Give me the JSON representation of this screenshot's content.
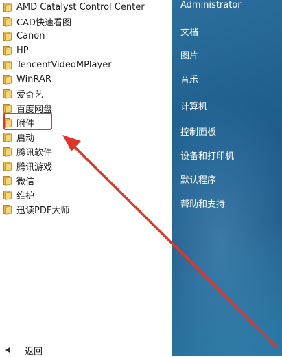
{
  "programs": [
    {
      "label": "AMD Catalyst Control Center",
      "icon": "folder-icon"
    },
    {
      "label": "CAD快速看图",
      "icon": "folder-icon"
    },
    {
      "label": "Canon",
      "icon": "folder-icon"
    },
    {
      "label": "HP",
      "icon": "folder-icon"
    },
    {
      "label": "TencentVideoMPlayer",
      "icon": "folder-icon"
    },
    {
      "label": "WinRAR",
      "icon": "folder-icon"
    },
    {
      "label": "爱奇艺",
      "icon": "folder-icon"
    },
    {
      "label": "百度网盘",
      "icon": "folder-icon"
    },
    {
      "label": "附件",
      "icon": "folder-icon"
    },
    {
      "label": "启动",
      "icon": "folder-icon"
    },
    {
      "label": "腾讯软件",
      "icon": "folder-icon"
    },
    {
      "label": "腾讯游戏",
      "icon": "folder-icon"
    },
    {
      "label": "微信",
      "icon": "folder-icon"
    },
    {
      "label": "维护",
      "icon": "folder-icon"
    },
    {
      "label": "迅读PDF大师",
      "icon": "folder-icon"
    }
  ],
  "back": {
    "label": "返回"
  },
  "right_panel": {
    "user": "Administrator",
    "items": [
      "文档",
      "图片",
      "音乐",
      "计算机",
      "控制面板",
      "设备和打印机",
      "默认程序",
      "帮助和支持"
    ]
  },
  "annotation": {
    "color": "#e0362a",
    "highlighted_item": "附件"
  }
}
